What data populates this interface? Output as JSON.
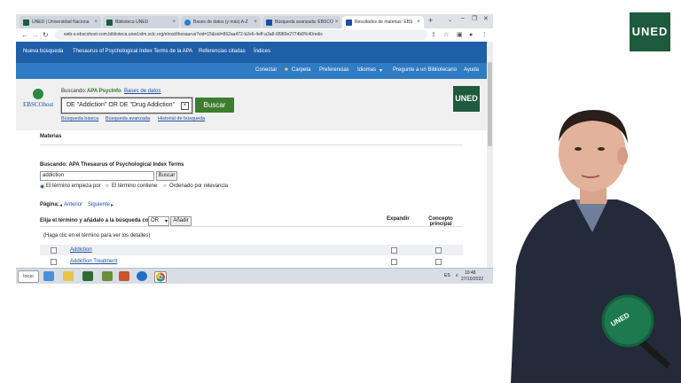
{
  "browser": {
    "tabs": [
      {
        "label": "UNED | Universidad Naciona",
        "color": "#1e5a3c"
      },
      {
        "label": "Biblioteca UNED",
        "color": "#1e5a3c"
      },
      {
        "label": "Bases de datos (y más) A-Z",
        "color": "#2b7fd4"
      },
      {
        "label": "Búsqueda avanzada: EBSCO",
        "color": "#1a4fa0"
      },
      {
        "label": "Resultados de materias: EBS",
        "color": "#1a4fa0"
      }
    ],
    "new_tab": "+",
    "url": "web-s-ebscohost-com.biblioteca.uned.idm.oclc.org/ehost/thesaurus?vid=15&sid=862aa472-b2e6-4eff-a3a8-6f989e2774b8%40redis"
  },
  "ebsco": {
    "topnav": [
      "Nueva búsqueda",
      "Thesaurus of Psychological Index Terms de la APA",
      "Referencias citadas",
      "Índices"
    ],
    "subnav": [
      "Conectar",
      "Carpeta",
      "Preferencias",
      "Idiomas",
      "Pregunte a un Bibliotecario",
      "Ayuda"
    ],
    "logo_text": "EBSCOhost",
    "searching_label": "Buscando:",
    "searching_db": "APA PsycInfo",
    "databases_link": "Bases de datos",
    "query": "DE \"Addiction\" OR DE \"Drug Addiction\"",
    "search_button": "Buscar",
    "links": [
      "Búsqueda básica",
      "Búsqueda avanzada",
      "Historial de búsqueda"
    ],
    "uned_logo": "UNED"
  },
  "thesaurus": {
    "section_title": "Materias",
    "browse_label": "Buscando: APA Thesaurus of Psychological Index Terms",
    "browse_value": "addiction",
    "browse_button": "Buscar",
    "radios": [
      "El término empieza por",
      "El término contiene",
      "Ordenado por relevancia"
    ],
    "page_label": "Página:",
    "prev": "Anterior",
    "next": "Siguiente",
    "select_label": "Elija el término y añádalo a la búsqueda con:",
    "operator": "OR",
    "add_button": "Añadir",
    "col_expand": "Expandir",
    "col_main": "Concepto principal",
    "hint": "(Haga clic en el término para ver los detalles)",
    "terms": [
      "Addiction",
      "Addiction Treatment"
    ]
  },
  "taskbar": {
    "start": "Inicio",
    "lang": "ES",
    "time": "10:48",
    "date": "27/10/2022"
  },
  "watermark": "UNED",
  "mic_text": "UNED",
  "colors": {
    "uned_green": "#1e5a3c",
    "ebsco_blue": "#1f5fa8",
    "ebsco_blue_light": "#2f7bc4",
    "search_btn": "#3e7d2f"
  }
}
